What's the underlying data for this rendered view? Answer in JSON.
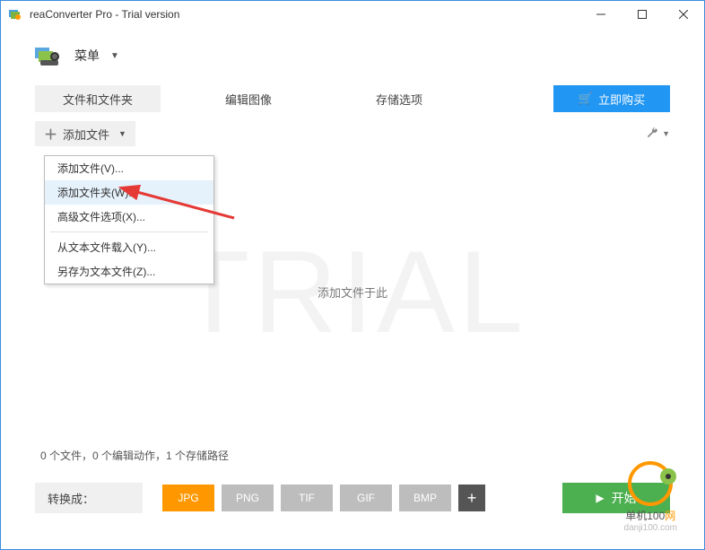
{
  "window": {
    "title": "reaConverter Pro - Trial version"
  },
  "menu": {
    "label": "菜单"
  },
  "tabs": {
    "files": "文件和文件夹",
    "edit": "编辑图像",
    "save": "存储选项"
  },
  "buy": {
    "label": "立即购买"
  },
  "addFiles": {
    "label": "添加文件"
  },
  "dropdown": {
    "addFilesV": "添加文件(V)...",
    "addFolderW": "添加文件夹(W)...",
    "advancedX": "高级文件选项(X)...",
    "loadFromTextY": "从文本文件载入(Y)...",
    "saveAsTextZ": "另存为文本文件(Z)..."
  },
  "main": {
    "watermark": "TRIAL",
    "prompt": "添加文件于此"
  },
  "status": {
    "text": "0 个文件，0 个编辑动作，1 个存储路径"
  },
  "bottom": {
    "convertTo": "转换成：",
    "start": "开始"
  },
  "formats": {
    "jpg": "JPG",
    "png": "PNG",
    "tif": "TIF",
    "gif": "GIF",
    "bmp": "BMP"
  },
  "brand": {
    "name_pre": "单机100",
    "name_suf": "网",
    "url": "danji100.com"
  }
}
